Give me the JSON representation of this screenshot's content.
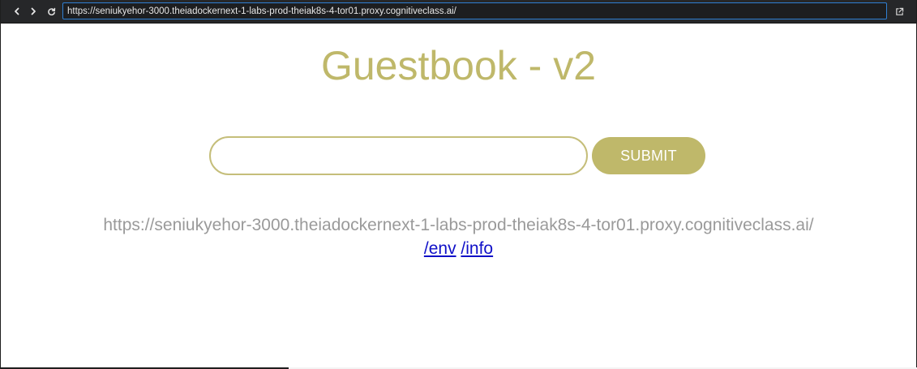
{
  "browser": {
    "url": "https://seniukyehor-3000.theiadockernext-1-labs-prod-theiak8s-4-tor01.proxy.cognitiveclass.ai/",
    "icons": {
      "back": "chevron-left-icon",
      "forward": "chevron-right-icon",
      "reload": "reload-icon",
      "external": "external-link-icon"
    },
    "accent_color": "#2f7fd3"
  },
  "page": {
    "title": "Guestbook - v2",
    "entry": {
      "value": "",
      "placeholder": ""
    },
    "submit_label": "SUBMIT",
    "host_text": "https://seniukyehor-3000.theiadockernext-1-labs-prod-theiak8s-4-tor01.proxy.cognitiveclass.ai/",
    "links": {
      "env": "/env",
      "info": "/info"
    },
    "colors": {
      "brand": "#bfb86a",
      "link": "#1010c8",
      "muted_text": "#9a9a9a"
    }
  }
}
